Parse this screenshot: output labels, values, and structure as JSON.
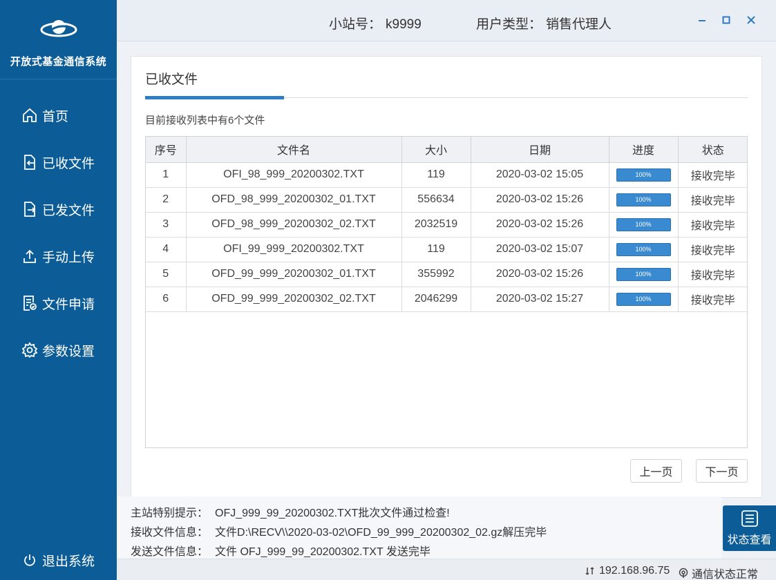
{
  "app": {
    "title": "开放式基金通信系统"
  },
  "sidebar": {
    "items": [
      {
        "label": "首页",
        "icon": "home-icon"
      },
      {
        "label": "已收文件",
        "icon": "file-received-icon"
      },
      {
        "label": "已发文件",
        "icon": "file-sent-icon"
      },
      {
        "label": "手动上传",
        "icon": "upload-icon"
      },
      {
        "label": "文件申请",
        "icon": "file-request-icon"
      },
      {
        "label": "参数设置",
        "icon": "gear-icon"
      }
    ],
    "logout_label": "退出系统"
  },
  "header": {
    "station_label": "小站号：",
    "station_value": "k9999",
    "usertype_label": "用户类型：",
    "usertype_value": "销售代理人"
  },
  "panel": {
    "title": "已收文件",
    "count_text": "目前接收列表中有6个文件",
    "columns": [
      "序号",
      "文件名",
      "大小",
      "日期",
      "进度",
      "状态"
    ],
    "rows": [
      {
        "no": "1",
        "name": "OFI_98_999_20200302.TXT",
        "size": "119",
        "date": "2020-03-02 15:05",
        "progress": "100%",
        "status": "接收完毕"
      },
      {
        "no": "2",
        "name": "OFD_98_999_20200302_01.TXT",
        "size": "556634",
        "date": "2020-03-02 15:26",
        "progress": "100%",
        "status": "接收完毕"
      },
      {
        "no": "3",
        "name": "OFD_98_999_20200302_02.TXT",
        "size": "2032519",
        "date": "2020-03-02 15:26",
        "progress": "100%",
        "status": "接收完毕"
      },
      {
        "no": "4",
        "name": "OFI_99_999_20200302.TXT",
        "size": "119",
        "date": "2020-03-02 15:07",
        "progress": "100%",
        "status": "接收完毕"
      },
      {
        "no": "5",
        "name": "OFD_99_999_20200302_01.TXT",
        "size": "355992",
        "date": "2020-03-02 15:26",
        "progress": "100%",
        "status": "接收完毕"
      },
      {
        "no": "6",
        "name": "OFD_99_999_20200302_02.TXT",
        "size": "2046299",
        "date": "2020-03-02 15:27",
        "progress": "100%",
        "status": "接收完毕"
      }
    ],
    "prev_label": "上一页",
    "next_label": "下一页"
  },
  "messages": {
    "notice_label": "主站特别提示：",
    "notice_value": "OFJ_999_99_20200302.TXT批次文件通过检查!",
    "recv_label": "接收文件信息：",
    "recv_value": "文件D:\\RECV\\\\2020-03-02\\OFD_99_999_20200302_02.gz解压完毕",
    "send_label": "发送文件信息：",
    "send_value": "文件 OFJ_999_99_20200302.TXT 发送完毕"
  },
  "status_button": {
    "label": "状态查看"
  },
  "statusbar": {
    "ip": "192.168.96.75",
    "connection": "通信状态正常"
  },
  "colors": {
    "sidebar": "#0c5d97",
    "accent": "#2d7ec4",
    "progress": "#3a8ad1"
  }
}
